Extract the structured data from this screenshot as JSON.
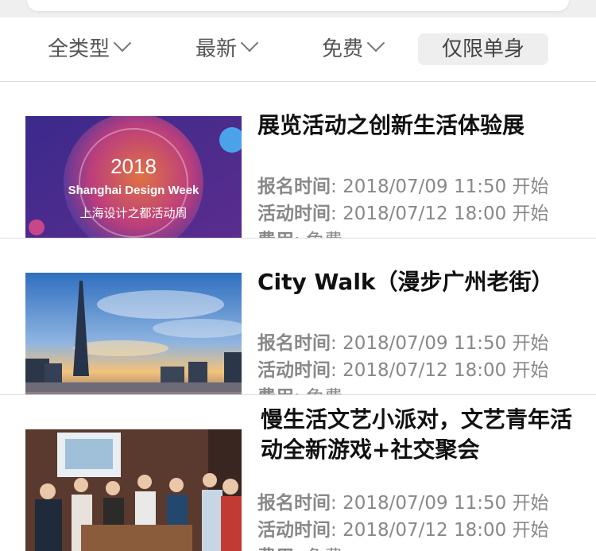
{
  "filters": {
    "type": "全类型",
    "sort": "最新",
    "fee": "免费",
    "single_only": "仅限单身"
  },
  "events": [
    {
      "title": "展览活动之创新生活体验展",
      "thumb_year": "2018",
      "thumb_line1": "Shanghai Design Week",
      "thumb_line2": "上海设计之都活动周",
      "register_label": "报名时间",
      "register_value": "2018/07/09 11:50 开始",
      "event_label": "活动时间",
      "event_value": "2018/07/12 18:00 开始",
      "fee_label": "费用",
      "fee_value": "免费"
    },
    {
      "title": "City Walk（漫步广州老街）",
      "register_label": "报名时间",
      "register_value": "2018/07/09 11:50 开始",
      "event_label": "活动时间",
      "event_value": "2018/07/12 18:00 开始",
      "fee_label": "费用",
      "fee_value": "免费"
    },
    {
      "title": "慢生活文艺小派对，文艺青年活动全新游戏+社交聚会",
      "register_label": "报名时间",
      "register_value": "2018/07/09 11:50 开始",
      "event_label": "活动时间",
      "event_value": "2018/07/12 18:00 开始",
      "fee_label": "费用",
      "fee_value": "免费"
    }
  ]
}
